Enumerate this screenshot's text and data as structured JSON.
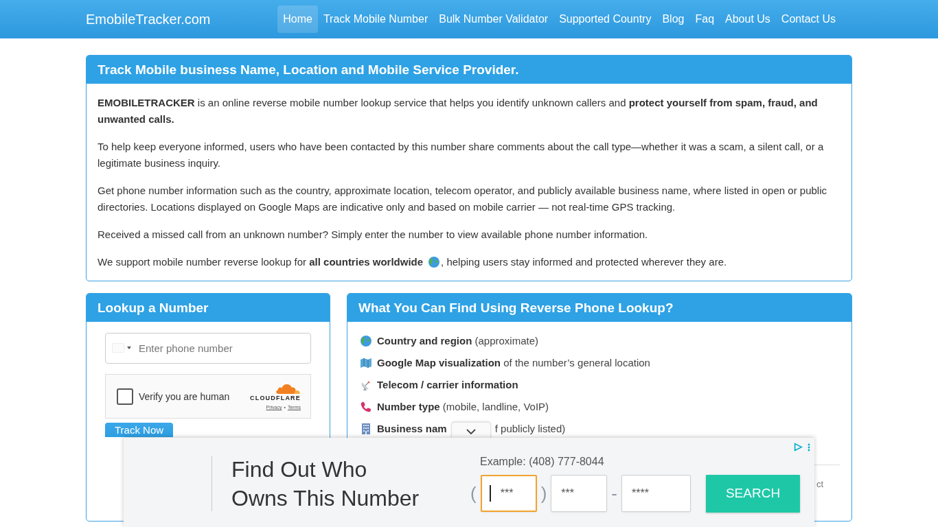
{
  "header": {
    "brand": "EmobileTracker.com",
    "nav": [
      {
        "label": "Home",
        "selected": true
      },
      {
        "label": "Track Mobile Number",
        "selected": false
      },
      {
        "label": "Bulk Number Validator",
        "selected": false
      },
      {
        "label": "Supported Country",
        "selected": false
      },
      {
        "label": "Blog",
        "selected": false
      },
      {
        "label": "Faq",
        "selected": false
      },
      {
        "label": "About Us",
        "selected": false
      },
      {
        "label": "Contact Us",
        "selected": false
      }
    ]
  },
  "intro_card": {
    "title": "Track Mobile business Name, Location and Mobile Service Provider.",
    "paragraphs": [
      {
        "text": "**EMOBILETRACKER** is an online reverse mobile number lookup service that helps you identify unknown callers and **protect yourself from spam, fraud, and unwanted calls.**"
      },
      {
        "text": "To help keep everyone informed, users who have been contacted by this number share comments about the call type—whether it was a scam, a silent call, or a legitimate business inquiry."
      },
      {
        "text": "Get phone number information such as the country, approximate location, telecom operator, and publicly available business name, where listed in open or public directories. Locations displayed on Google Maps are indicative only and based on mobile carrier — not real-time GPS tracking."
      },
      {
        "text": "Received a missed call from an unknown number? Simply enter the number to view available phone number information."
      },
      {
        "text": "We support mobile number reverse lookup for **all countries worldwide**",
        "text_after_icon": ", helping users stay informed and protected wherever they are."
      }
    ]
  },
  "lookup_card": {
    "title": "Lookup a Number",
    "phone_field": {
      "placeholder": "Enter phone number"
    },
    "captcha": {
      "checked": false,
      "label": "Verify you are human",
      "brand": "CLOUDFLARE",
      "links": [
        "Privacy",
        "Terms"
      ],
      "link_separator": "•"
    },
    "submit": "Track Now"
  },
  "features_card": {
    "title": "What You Can Find Using Reverse Phone Lookup?",
    "items": [
      {
        "label": "Country and region",
        "detail": "(approximate)"
      },
      {
        "label": "Google Map visualization",
        "detail": "of the number’s general location"
      },
      {
        "label": "Telecom / carrier information"
      },
      {
        "label": "Number type",
        "detail": "(mobile, landline, VoIP)"
      },
      {
        "label": "Business nam",
        "detail": "f publicly listed)",
        "collapse_tab": true
      }
    ],
    "footer_note": "ct"
  },
  "ad": {
    "headline": [
      "Find Out Who",
      "Owns This Number"
    ],
    "example": "Example: (408) 777-8044",
    "parts": [
      {
        "kind": "sep",
        "text": "("
      },
      {
        "kind": "field",
        "placeholder": "***",
        "focused": true
      },
      {
        "kind": "sep",
        "text": ")"
      },
      {
        "kind": "field",
        "placeholder": "***",
        "focused": false
      },
      {
        "kind": "sep",
        "text": "-"
      },
      {
        "kind": "field",
        "placeholder": "****",
        "focused": false
      }
    ],
    "button": "SEARCH"
  }
}
